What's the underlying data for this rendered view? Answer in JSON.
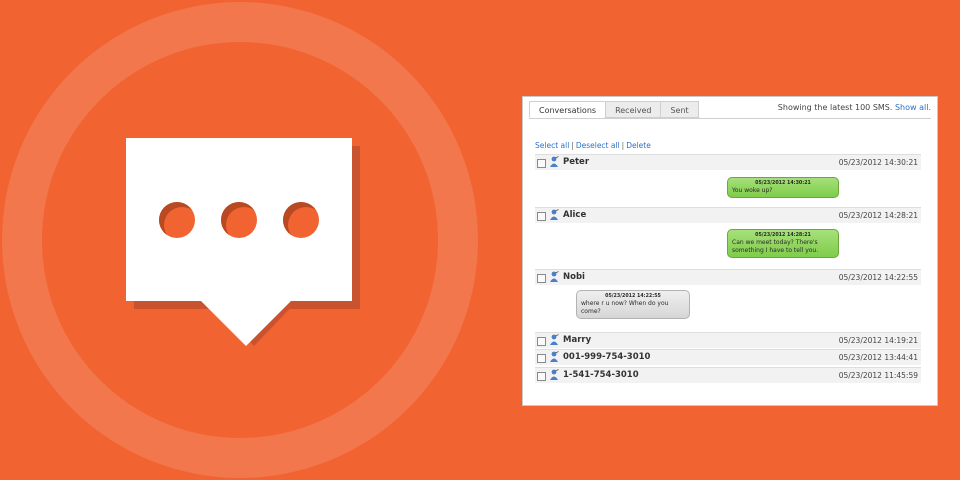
{
  "tabs": [
    {
      "label": "Conversations",
      "active": true
    },
    {
      "label": "Received",
      "active": false
    },
    {
      "label": "Sent",
      "active": false
    }
  ],
  "showing": {
    "text": "Showing the latest 100 SMS.",
    "link": "Show all."
  },
  "actions": {
    "select_all": "Select all",
    "deselect_all": "Deselect all",
    "delete": "Delete"
  },
  "conversations": [
    {
      "name": "Peter",
      "date": "05/23/2012 14:30:21",
      "message": {
        "timestamp": "05/23/2012 14:30:21",
        "text": "You woke up?",
        "direction": "sent"
      }
    },
    {
      "name": "Alice",
      "date": "05/23/2012 14:28:21",
      "message": {
        "timestamp": "05/23/2012 14:28:21",
        "text": "Can we meet today? There's something I have to tell you.",
        "direction": "sent"
      }
    },
    {
      "name": "Nobi",
      "date": "05/23/2012 14:22:55",
      "message": {
        "timestamp": "05/23/2012 14:22:55",
        "text": "where r u now? When do you come?",
        "direction": "received"
      }
    },
    {
      "name": "Marry",
      "date": "05/23/2012 14:19:21"
    },
    {
      "name": "001-999-754-3010",
      "date": "05/23/2012 13:44:41"
    },
    {
      "name": "1-541-754-3010",
      "date": "05/23/2012 11:45:59"
    }
  ],
  "colors": {
    "background": "#f26332",
    "sent_bubble": "#8fd45c",
    "received_bubble": "#e3e3e3",
    "link": "#2a73c7"
  },
  "icons": {
    "logo": "speech-bubble-ellipsis-icon",
    "contact": "contact-person-icon"
  }
}
